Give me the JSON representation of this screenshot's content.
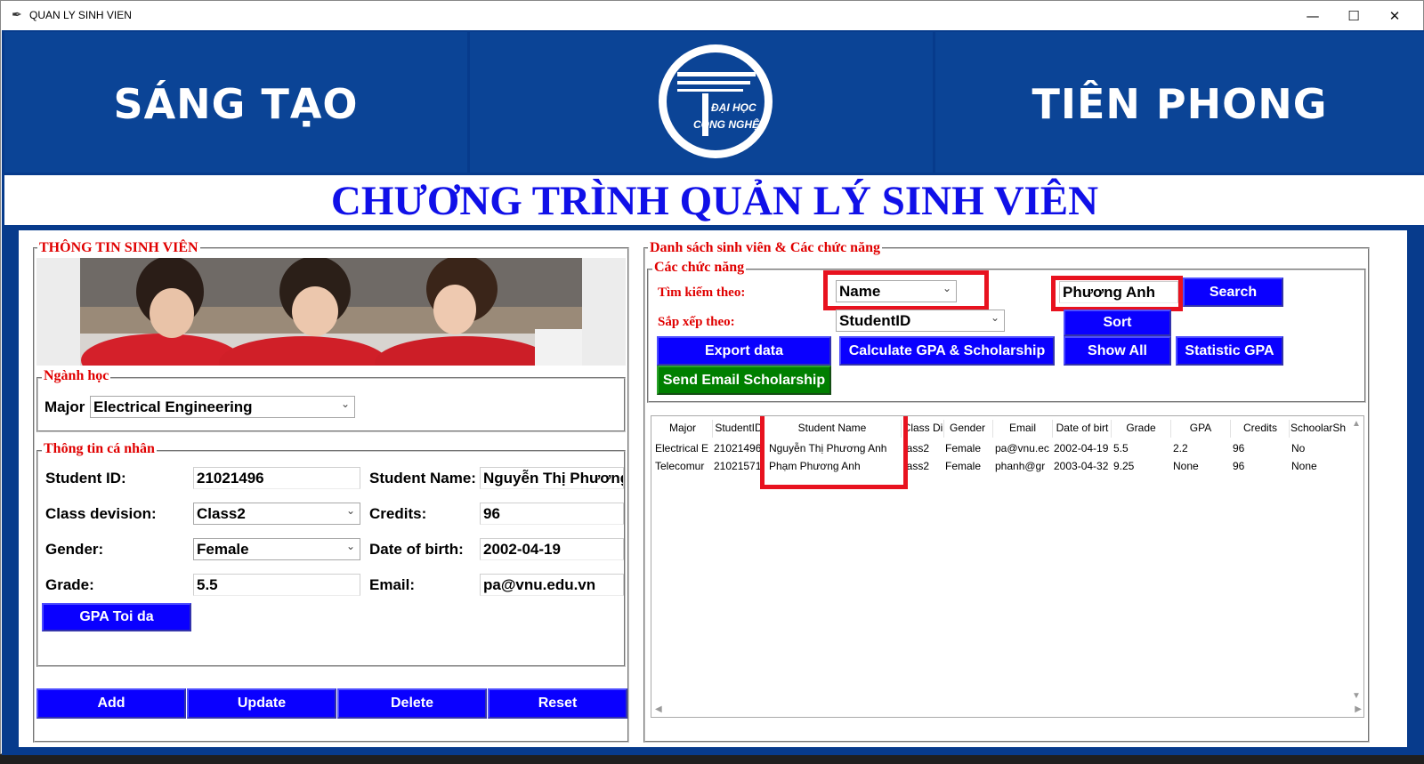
{
  "window": {
    "title": "QUAN LY SINH VIEN"
  },
  "banner": {
    "left_text": "SÁNG TẠO",
    "right_text": "TIÊN PHONG",
    "logo_line1": "ĐẠI HỌC",
    "logo_line2": "CÔNG NGHỆ"
  },
  "main_title": "CHƯƠNG TRÌNH QUẢN LÝ SINH VIÊN",
  "left_panel": {
    "group_title": "THÔNG TIN SINH VIÊN",
    "major_group": {
      "title": "Ngành học",
      "label": "Major",
      "value": "Electrical Engineering"
    },
    "personal_group": {
      "title": "Thông tin cá nhân",
      "student_id_label": "Student ID:",
      "student_id": "21021496",
      "student_name_label": "Student Name:",
      "student_name": "Nguyễn Thị Phương",
      "class_label": "Class devision:",
      "class_value": "Class2",
      "credits_label": "Credits:",
      "credits": "96",
      "gender_label": "Gender:",
      "gender": "Female",
      "dob_label": "Date of birth:",
      "dob": "2002-04-19",
      "grade_label": "Grade:",
      "grade": "5.5",
      "email_label": "Email:",
      "email": "pa@vnu.edu.vn",
      "gpa_button": "GPA Toi da"
    },
    "buttons": {
      "add": "Add",
      "update": "Update",
      "delete": "Delete",
      "reset": "Reset"
    }
  },
  "right_panel": {
    "group_title": "Danh sách sinh viên & Các chức năng",
    "functions_title": "Các chức năng",
    "search_by_label": "Tìm kiếm theo:",
    "search_by_value": "Name",
    "sort_by_label": "Sắp xếp theo:",
    "sort_by_value": "StudentID",
    "search_input": "Phương Anh",
    "buttons": {
      "search": "Search",
      "sort": "Sort",
      "export": "Export data",
      "calculate": "Calculate GPA & Scholarship",
      "show_all": "Show All",
      "statistic": "Statistic GPA",
      "send_email": "Send Email Scholarship"
    },
    "table": {
      "columns": [
        "Major",
        "StudentID",
        "Student Name",
        "Class Di",
        "Gender",
        "Email",
        "Date of birt",
        "Grade",
        "GPA",
        "Credits",
        "SchoolarSh"
      ],
      "rows": [
        [
          "Electrical E",
          "21021496",
          "Nguyễn Thị Phương Anh",
          "lass2",
          "Female",
          "pa@vnu.ec",
          "2002-04-19",
          "5.5",
          "2.2",
          "96",
          "No"
        ],
        [
          "Telecomur",
          "21021571",
          "Phạm Phương Anh",
          "lass2",
          "Female",
          "phanh@gr",
          "2003-04-32",
          "9.25",
          "None",
          "96",
          "None"
        ]
      ]
    }
  }
}
